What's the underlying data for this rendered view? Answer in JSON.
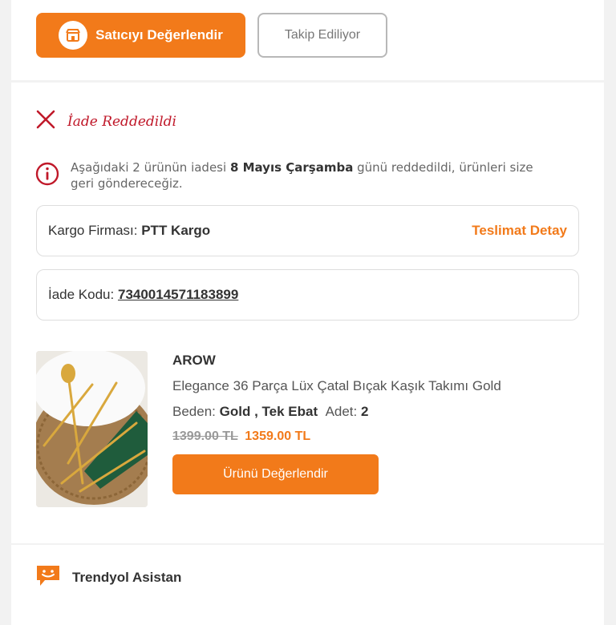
{
  "seller_actions": {
    "rate_seller_label": "Satıcıyı Değerlendir",
    "following_label": "Takip Ediliyor"
  },
  "return_status": {
    "label": "İade Reddedildi",
    "notice_prefix": "Aşağıdaki 2 ürünün iadesi ",
    "notice_date": "8 Mayıs Çarşamba",
    "notice_suffix": " günü reddedildi, ürünleri size geri göndereceğiz."
  },
  "cargo": {
    "label": "Kargo Firması:",
    "company": "PTT Kargo",
    "details_link": "Teslimat Detay"
  },
  "return_code": {
    "label": "İade Kodu:",
    "value": "7340014571183899"
  },
  "product": {
    "brand": "AROW",
    "name": "Elegance 36 Parça Lüx Çatal Bıçak Kaşık Takımı Gold",
    "size_label": "Beden:",
    "size_value": "Gold , Tek Ebat",
    "qty_label": "Adet:",
    "qty_value": "2",
    "old_price": "1399.00 TL",
    "new_price": "1359.00 TL",
    "rate_button": "Ürünü Değerlendir"
  },
  "assistant": {
    "label": "Trendyol Asistan"
  },
  "colors": {
    "accent": "#f27a1a",
    "error": "#c0192a"
  }
}
